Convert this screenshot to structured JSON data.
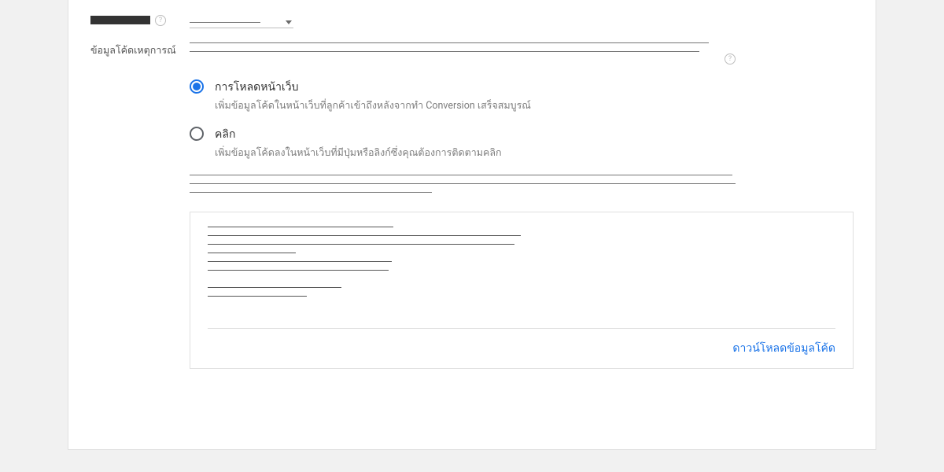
{
  "dropdown_row": {
    "help_char": "?"
  },
  "section_label": "ข้อมูลโค้ดเหตุการณ์",
  "intro_help_char": "?",
  "radio_options": {
    "page_load": {
      "title": "การโหลดหน้าเว็บ",
      "desc": "เพิ่มข้อมูลโค้ดในหน้าเว็บที่ลูกค้าเข้าถึงหลังจากทำ Conversion เสร็จสมบูรณ์"
    },
    "click": {
      "title": "คลิก",
      "desc": "เพิ่มข้อมูลโค้ดลงในหน้าเว็บที่มีปุ่มหรือลิงก์ซึ่งคุณต้องการติดตามคลิก"
    }
  },
  "download_label": "ดาวน์โหลดข้อมูลโค้ด"
}
